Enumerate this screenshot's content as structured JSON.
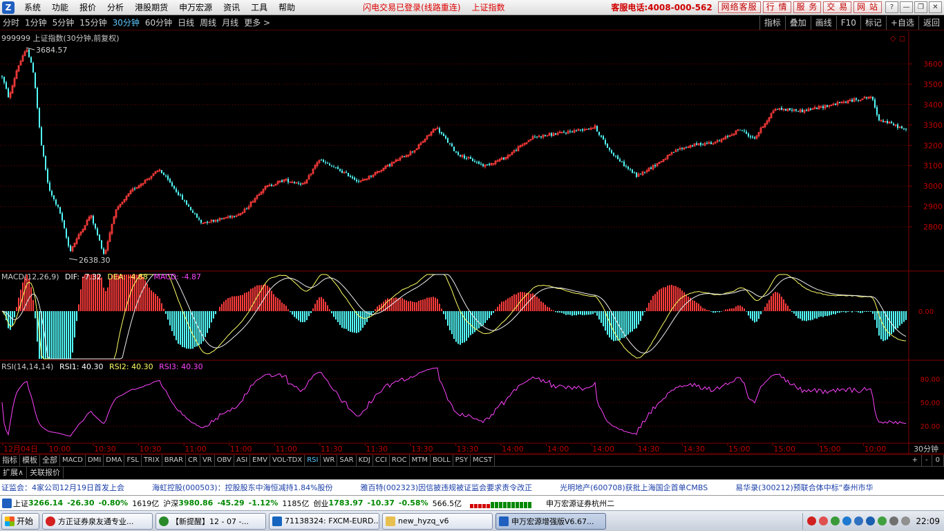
{
  "menubar": {
    "logo": "Z",
    "menu": [
      "系统",
      "功能",
      "报价",
      "分析",
      "港股期货",
      "申万宏源",
      "资讯",
      "工具",
      "帮助"
    ],
    "status": "闪电交易已登录(线路重连)",
    "current_index": "上证指数",
    "phone": "客服电话:4008-000-562",
    "buttons": [
      "网络客服",
      "行 情",
      "服 务",
      "交 易",
      "网 站"
    ],
    "window_buttons": [
      "?",
      "—",
      "❐",
      "✕"
    ]
  },
  "periods": {
    "items": [
      "分时",
      "1分钟",
      "5分钟",
      "15分钟",
      "30分钟",
      "60分钟",
      "日线",
      "周线",
      "月线",
      "更多 >"
    ],
    "active": "30分钟",
    "tools": [
      "指标",
      "叠加",
      "画线",
      "F10",
      "标记",
      "+自选",
      "返回"
    ]
  },
  "main_panel": {
    "title": "999999 上证指数(30分钟,前复权)",
    "high_label": "3684.57",
    "low_label": "2638.30",
    "corner_icons": [
      "◇",
      "◻"
    ]
  },
  "macd_panel": {
    "title_prefix": "MACD(12,26,9)",
    "dif": "DIF: -7.32",
    "dea": "DEA: -4.88",
    "macd": "MACD: -4.87"
  },
  "rsi_panel": {
    "title_prefix": "RSI(14,14,14)",
    "rsi1": "RSI1: 40.30",
    "rsi2": "RSI2: 40.30",
    "rsi3": "RSI3: 40.30"
  },
  "x_axis": {
    "labels": [
      "12月04日",
      "10:00",
      "10:30",
      "10:30",
      "11:00",
      "11:00",
      "11:00",
      "11:30",
      "11:30",
      "13:30",
      "13:30",
      "14:00",
      "14:00",
      "14:00",
      "14:30",
      "14:30",
      "15:00",
      "15:00",
      "15:00",
      "10:00"
    ],
    "period_label": "30分钟"
  },
  "indicator_tabs": {
    "items": [
      "指标",
      "模板",
      "全部",
      "MACD",
      "DMI",
      "DMA",
      "FSL",
      "TRIX",
      "BRAR",
      "CR",
      "VR",
      "OBV",
      "ASI",
      "EMV",
      "VOL-TDX",
      "RSI",
      "WR",
      "SAR",
      "KDJ",
      "CCI",
      "ROC",
      "MTM",
      "BOLL",
      "PSY",
      "MCST"
    ],
    "active": "RSI",
    "right": [
      "+",
      "-",
      "0"
    ]
  },
  "subtabs": [
    "扩展∧",
    "关联报价"
  ],
  "ticker": [
    "证监会：4家公司12月19日首发上会",
    "海虹控股(000503)：控股股东中海恒减持1.84%股份",
    "雅百特(002323)因信披违规被证监会要求责令改正",
    "光明地产(600708)获批上海国企首单CMBS",
    "易华录(300212)预联合体中标“泰州市华"
  ],
  "indices": [
    {
      "name": "上证",
      "value": "3266.14",
      "change": "-26.30",
      "pct": "-0.80%",
      "vol": "1619亿"
    },
    {
      "name": "沪深",
      "value": "3980.86",
      "change": "-45.29",
      "pct": "-1.12%",
      "vol": "1185亿"
    },
    {
      "name": "创业",
      "value": "1783.97",
      "change": "-10.37",
      "pct": "-0.58%",
      "vol": "566.5亿"
    }
  ],
  "broker": "申万宏源证券杭州二",
  "taskbar": {
    "start": "开始",
    "tasks": [
      {
        "label": "方正证券泉友通专业...",
        "color": "#d42020",
        "active": false
      },
      {
        "label": "【新提醒】12 - 07 -...",
        "color": "#2a5fd0",
        "active": false
      },
      {
        "label": "71138324: FXCM-EURD...",
        "color": "#1565c0",
        "active": false
      },
      {
        "label": "new_hyzq_v6",
        "color": "#e8c050",
        "active": false
      },
      {
        "label": "申万宏源增强版V6.67...",
        "color": "#1e5fbf",
        "active": true
      }
    ],
    "clock": "22:09"
  },
  "chart_data": [
    {
      "type": "candlestick",
      "title": "999999 上证指数(30分钟,前复权)",
      "y_ticks": [
        2800,
        2900,
        3000,
        3100,
        3200,
        3300,
        3400,
        3500,
        3600
      ],
      "ylim": [
        2600,
        3700
      ],
      "high": 3684.57,
      "low": 2638.3,
      "approx_close_path": [
        [
          0,
          3560
        ],
        [
          12,
          3430
        ],
        [
          24,
          3580
        ],
        [
          38,
          3675
        ],
        [
          48,
          3550
        ],
        [
          58,
          3220
        ],
        [
          70,
          2980
        ],
        [
          85,
          2880
        ],
        [
          100,
          2680
        ],
        [
          110,
          2740
        ],
        [
          130,
          2860
        ],
        [
          150,
          2660
        ],
        [
          165,
          2870
        ],
        [
          190,
          2980
        ],
        [
          230,
          3080
        ],
        [
          260,
          2950
        ],
        [
          290,
          2820
        ],
        [
          320,
          2840
        ],
        [
          350,
          2870
        ],
        [
          380,
          2990
        ],
        [
          410,
          3030
        ],
        [
          440,
          3010
        ],
        [
          460,
          3130
        ],
        [
          500,
          3060
        ],
        [
          520,
          3020
        ],
        [
          560,
          3100
        ],
        [
          600,
          3180
        ],
        [
          630,
          3290
        ],
        [
          660,
          3160
        ],
        [
          700,
          3100
        ],
        [
          730,
          3140
        ],
        [
          770,
          3240
        ],
        [
          810,
          3260
        ],
        [
          860,
          3290
        ],
        [
          880,
          3180
        ],
        [
          900,
          3110
        ],
        [
          920,
          3050
        ],
        [
          950,
          3110
        ],
        [
          980,
          3180
        ],
        [
          1000,
          3200
        ],
        [
          1040,
          3220
        ],
        [
          1070,
          3280
        ],
        [
          1090,
          3230
        ],
        [
          1120,
          3380
        ],
        [
          1160,
          3370
        ],
        [
          1190,
          3390
        ],
        [
          1230,
          3420
        ],
        [
          1260,
          3440
        ],
        [
          1270,
          3330
        ],
        [
          1300,
          3290
        ],
        [
          1312,
          3270
        ]
      ]
    },
    {
      "type": "bar",
      "title": "MACD(12,26,9)",
      "y_ticks": [
        0.0
      ]
    },
    {
      "type": "line",
      "title": "RSI(14,14,14)",
      "y_ticks": [
        20.0,
        50.0,
        80.0
      ],
      "ylim": [
        0,
        100
      ]
    }
  ],
  "colors": {
    "up": "#ff3c3c",
    "down": "#54fcfc",
    "dif": "#ffff66",
    "rsi": "#ff44ff",
    "axis": "#800000"
  }
}
